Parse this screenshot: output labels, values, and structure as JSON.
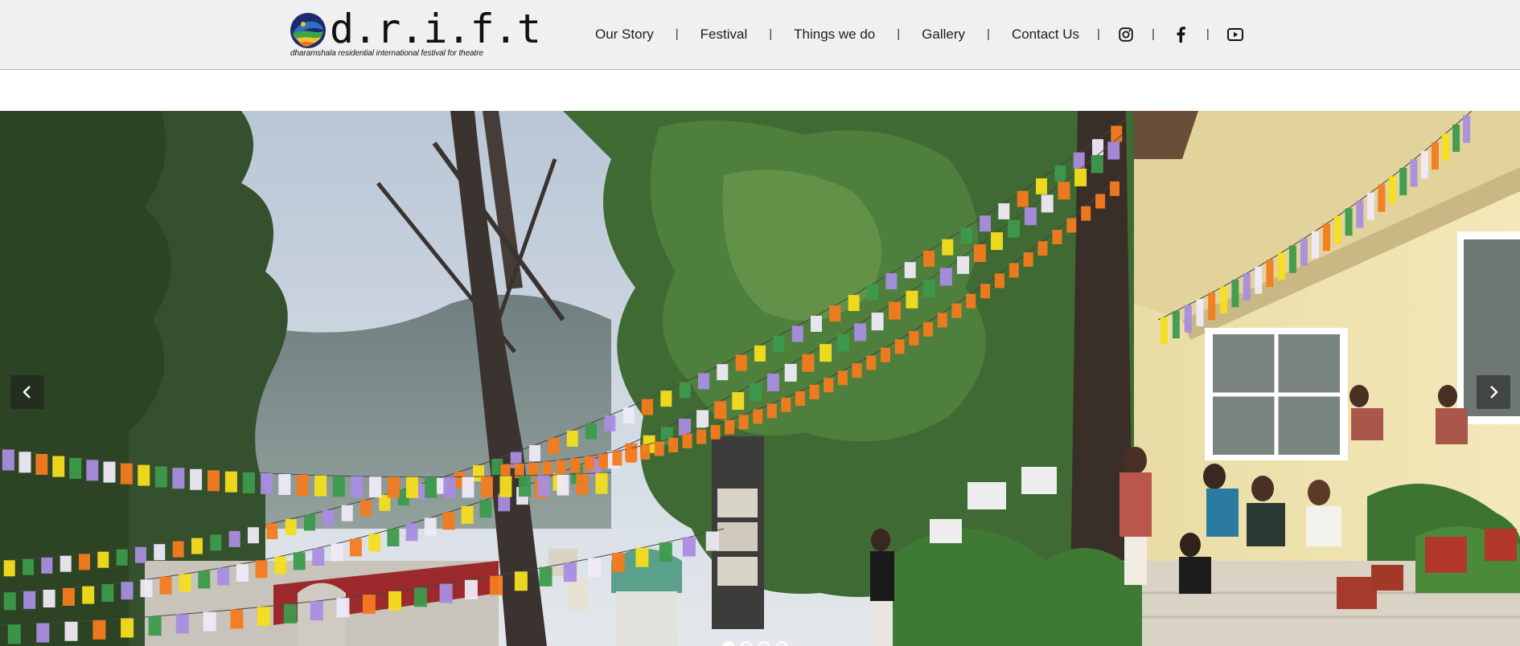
{
  "brand": {
    "wordmark": "d.r.i.f.t",
    "tagline": "dharamshala residential international festival for theatre",
    "logo_colors": {
      "outer": "#1d2a6b",
      "blue": "#2f6fc2",
      "green": "#3aa54a",
      "yellow": "#f1c232",
      "orange": "#e8761c"
    }
  },
  "nav": {
    "items": [
      {
        "label": "Our Story"
      },
      {
        "label": "Festival"
      },
      {
        "label": "Things we do"
      },
      {
        "label": "Gallery"
      },
      {
        "label": "Contact Us"
      }
    ],
    "separator": "|",
    "social": [
      {
        "icon": "instagram-icon"
      },
      {
        "icon": "facebook-icon"
      },
      {
        "icon": "youtube-icon"
      }
    ]
  },
  "hero": {
    "prev_icon": "chevron-left-icon",
    "next_icon": "chevron-right-icon",
    "slides_count": 4,
    "active_slide": 1,
    "flag_colors": [
      "#f6de1e",
      "#3c9a4c",
      "#a98de0",
      "#eeeaf7",
      "#f47b1f"
    ]
  }
}
